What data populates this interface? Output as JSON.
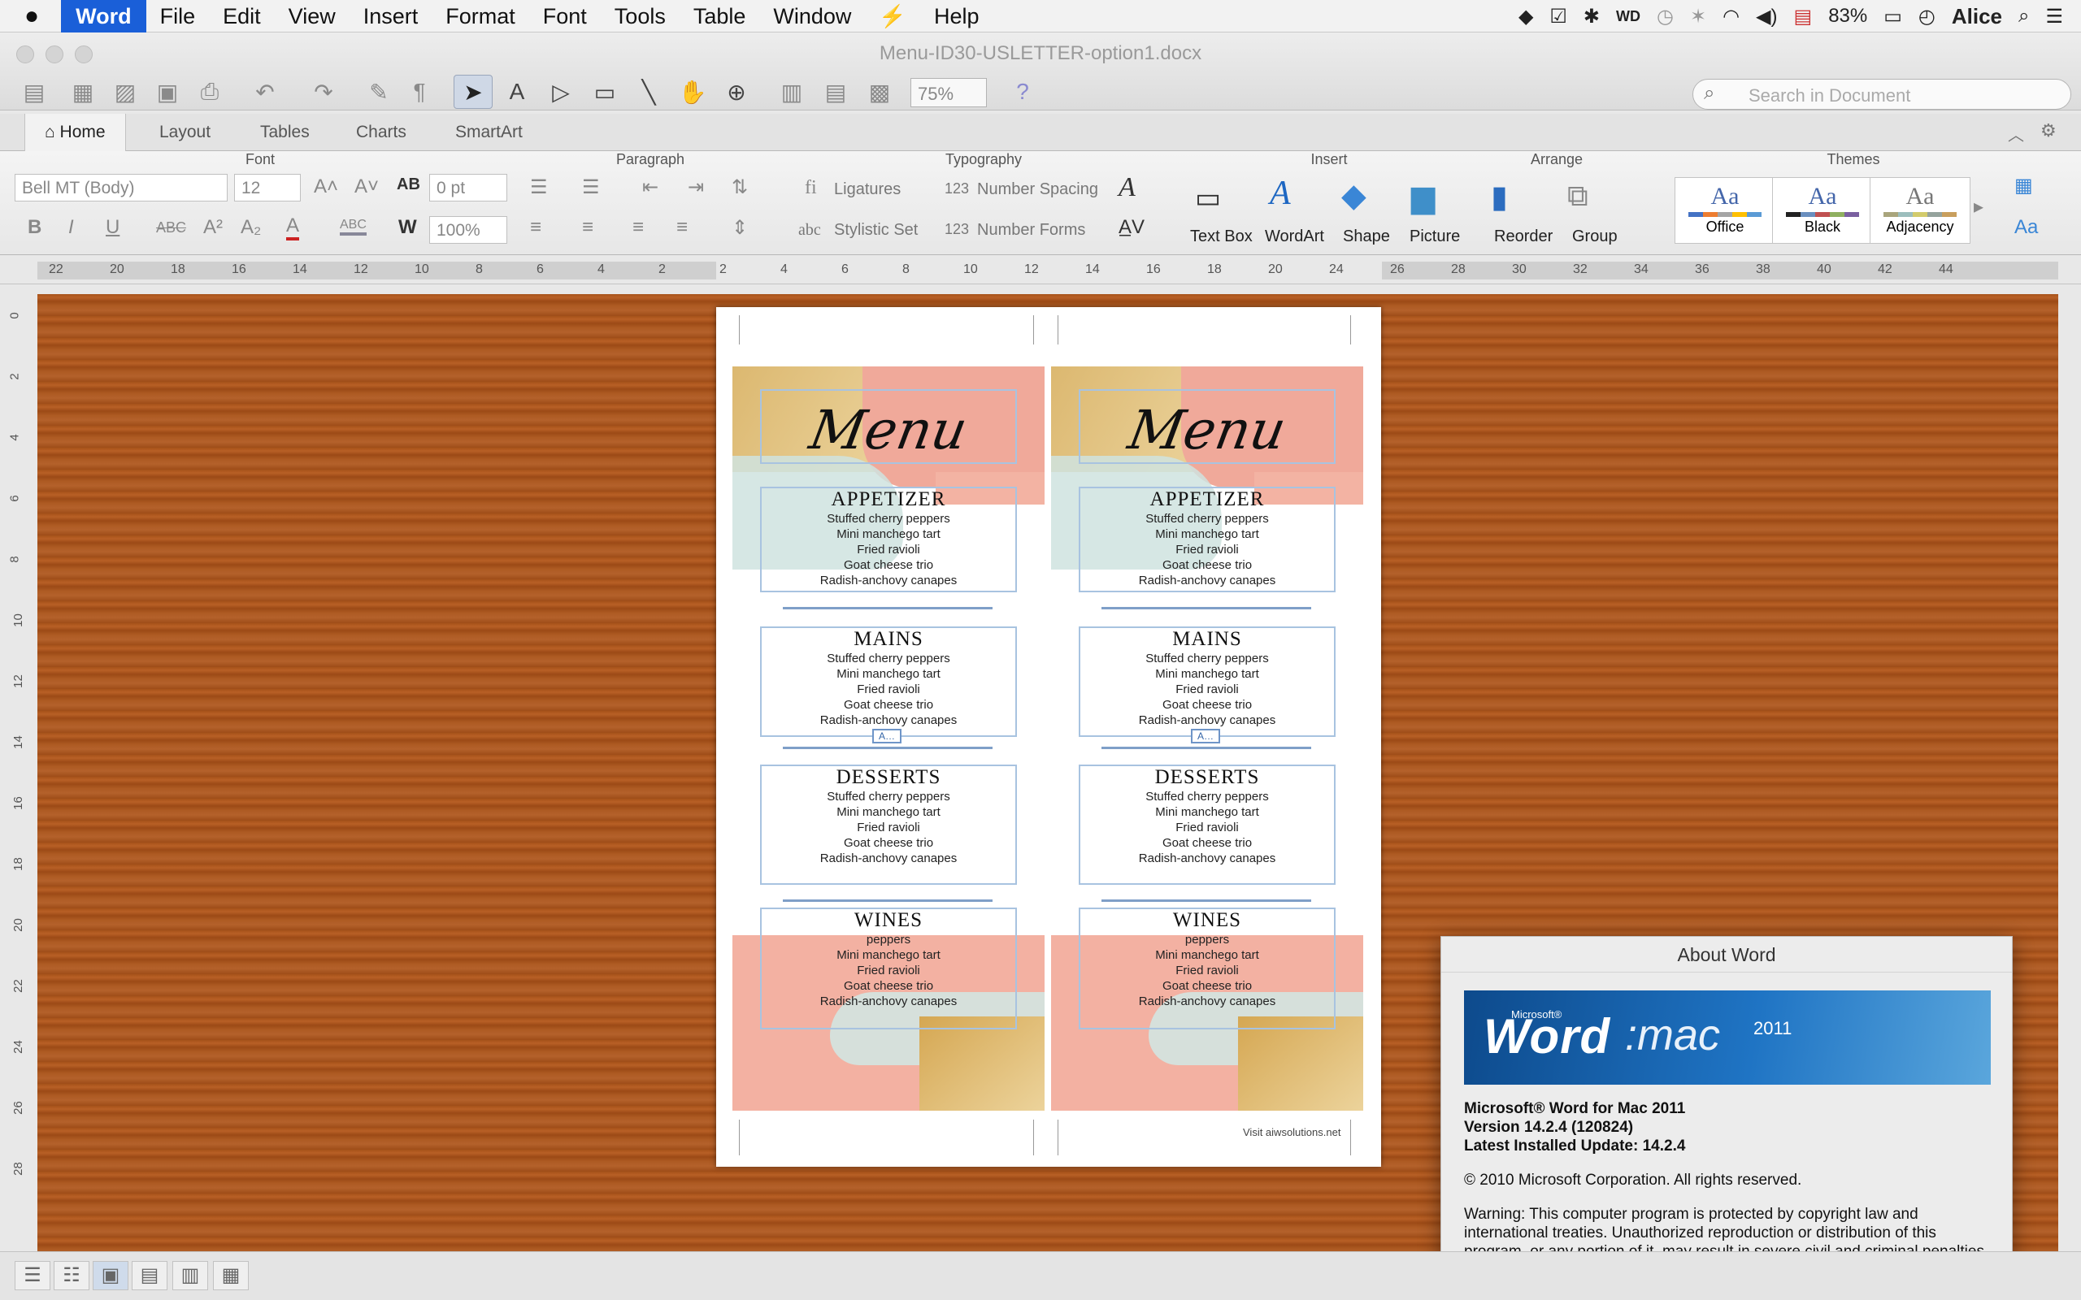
{
  "menubar": {
    "apple": "",
    "app": "Word",
    "items": [
      "File",
      "Edit",
      "View",
      "Insert",
      "Format",
      "Font",
      "Tools",
      "Table",
      "Window",
      "⚡",
      "Help"
    ],
    "status": {
      "battery": "83%",
      "user": "Alice"
    }
  },
  "window": {
    "title": "Menu-ID30-USLETTER-option1.docx",
    "zoom": "75%",
    "search_placeholder": "Search in Document"
  },
  "tabs": [
    "Home",
    "Layout",
    "Tables",
    "Charts",
    "SmartArt"
  ],
  "ribbon": {
    "font": {
      "title": "Font",
      "name": "Bell MT (Body)",
      "size": "12",
      "scale": "100%"
    },
    "paragraph": {
      "title": "Paragraph"
    },
    "typography": {
      "title": "Typography",
      "spacing": "0 pt",
      "ligatures": "Ligatures",
      "number_spacing": "Number Spacing",
      "stylistic_set": "Stylistic Set",
      "number_forms": "Number Forms"
    },
    "insert": {
      "title": "Insert",
      "items": [
        "Text Box",
        "WordArt",
        "Shape",
        "Picture"
      ]
    },
    "arrange": {
      "title": "Arrange",
      "items": [
        "Reorder",
        "Group"
      ]
    },
    "themes": {
      "title": "Themes",
      "items": [
        "Office",
        "Black",
        "Adjacency"
      ]
    }
  },
  "ruler": {
    "labels": [
      "22",
      "20",
      "18",
      "16",
      "14",
      "12",
      "10",
      "8",
      "6",
      "4",
      "2",
      "2",
      "4",
      "6",
      "8",
      "10",
      "12",
      "14",
      "16",
      "18",
      "20",
      "24",
      "26",
      "28",
      "30",
      "32",
      "34",
      "36",
      "38",
      "40",
      "42",
      "44"
    ]
  },
  "vruler": {
    "labels": [
      "0",
      "2",
      "4",
      "6",
      "8",
      "10",
      "12",
      "14",
      "16",
      "18",
      "20",
      "22",
      "24",
      "26",
      "28"
    ]
  },
  "menu_card": {
    "title": "Menu",
    "sections": [
      {
        "heading": "APPETIZER",
        "items": [
          "Stuffed cherry peppers",
          "Mini manchego tart",
          "Fried ravioli",
          "Goat cheese trio",
          "Radish-anchovy canapes"
        ]
      },
      {
        "heading": "MAINS",
        "items": [
          "Stuffed cherry peppers",
          "Mini manchego tart",
          "Fried ravioli",
          "Goat cheese trio",
          "Radish-anchovy canapes"
        ]
      },
      {
        "heading": "DESSERTS",
        "items": [
          "Stuffed cherry peppers",
          "Mini manchego tart",
          "Fried ravioli",
          "Goat cheese trio",
          "Radish-anchovy canapes"
        ]
      },
      {
        "heading": "WINES",
        "items": [
          "peppers",
          "Mini manchego tart",
          "Fried ravioli",
          "Goat cheese trio",
          "Radish-anchovy canapes"
        ]
      }
    ],
    "footer": "Visit aiwsolutions.net"
  },
  "about": {
    "title": "About Word",
    "banner": {
      "word": "Word",
      "colon_mac": ":mac",
      "year": "2011",
      "microsoft": "Microsoft®"
    },
    "product": "Microsoft® Word for Mac 2011",
    "version": "Version 14.2.4 (120824)",
    "update": "Latest Installed Update: 14.2.4",
    "copyright": "© 2010 Microsoft Corporation. All rights reserved.",
    "warning": "Warning: This computer program is protected by copyright law and international treaties.  Unauthorized reproduction or distribution of this program, or any portion of it, may result in severe civil and criminal penalties, and will be prosecuted to the maximum extent possible under the law."
  }
}
